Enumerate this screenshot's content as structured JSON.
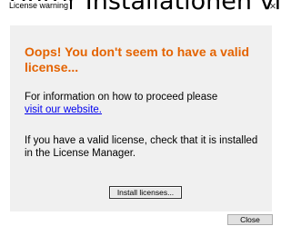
{
  "background": {
    "partial_text": "Unter Installationen vi"
  },
  "window": {
    "title": "License warning",
    "close_glyph": "×"
  },
  "message": {
    "heading": "Oops! You don't seem to have a valid license...",
    "info_text": "For information on how to proceed please",
    "link_text": "visit our website.",
    "license_text": "If you have a valid license, check that it is installed in the License Manager."
  },
  "buttons": {
    "install_label": "Install licenses...",
    "close_label": "Close"
  },
  "colors": {
    "heading": "#e46300",
    "link": "#0000ee",
    "panel": "#f0f0f0"
  }
}
